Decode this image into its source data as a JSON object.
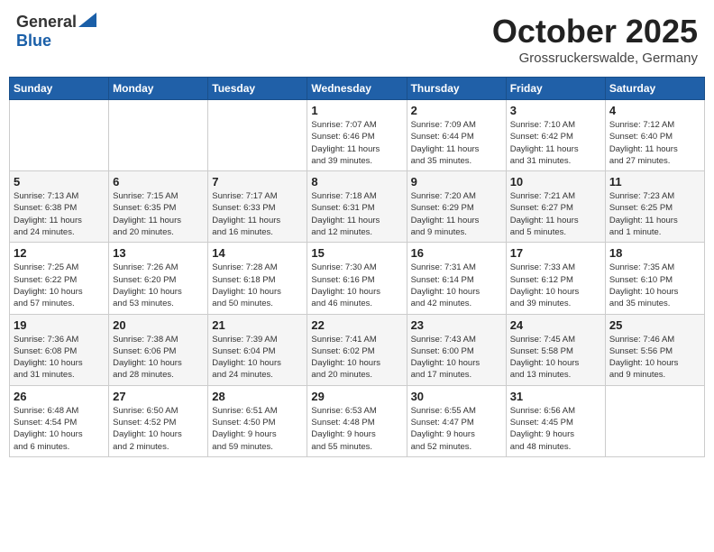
{
  "header": {
    "logo_general": "General",
    "logo_blue": "Blue",
    "month": "October 2025",
    "location": "Grossruckerswalde, Germany"
  },
  "days_of_week": [
    "Sunday",
    "Monday",
    "Tuesday",
    "Wednesday",
    "Thursday",
    "Friday",
    "Saturday"
  ],
  "weeks": [
    [
      {
        "day": "",
        "info": ""
      },
      {
        "day": "",
        "info": ""
      },
      {
        "day": "",
        "info": ""
      },
      {
        "day": "1",
        "info": "Sunrise: 7:07 AM\nSunset: 6:46 PM\nDaylight: 11 hours\nand 39 minutes."
      },
      {
        "day": "2",
        "info": "Sunrise: 7:09 AM\nSunset: 6:44 PM\nDaylight: 11 hours\nand 35 minutes."
      },
      {
        "day": "3",
        "info": "Sunrise: 7:10 AM\nSunset: 6:42 PM\nDaylight: 11 hours\nand 31 minutes."
      },
      {
        "day": "4",
        "info": "Sunrise: 7:12 AM\nSunset: 6:40 PM\nDaylight: 11 hours\nand 27 minutes."
      }
    ],
    [
      {
        "day": "5",
        "info": "Sunrise: 7:13 AM\nSunset: 6:38 PM\nDaylight: 11 hours\nand 24 minutes."
      },
      {
        "day": "6",
        "info": "Sunrise: 7:15 AM\nSunset: 6:35 PM\nDaylight: 11 hours\nand 20 minutes."
      },
      {
        "day": "7",
        "info": "Sunrise: 7:17 AM\nSunset: 6:33 PM\nDaylight: 11 hours\nand 16 minutes."
      },
      {
        "day": "8",
        "info": "Sunrise: 7:18 AM\nSunset: 6:31 PM\nDaylight: 11 hours\nand 12 minutes."
      },
      {
        "day": "9",
        "info": "Sunrise: 7:20 AM\nSunset: 6:29 PM\nDaylight: 11 hours\nand 9 minutes."
      },
      {
        "day": "10",
        "info": "Sunrise: 7:21 AM\nSunset: 6:27 PM\nDaylight: 11 hours\nand 5 minutes."
      },
      {
        "day": "11",
        "info": "Sunrise: 7:23 AM\nSunset: 6:25 PM\nDaylight: 11 hours\nand 1 minute."
      }
    ],
    [
      {
        "day": "12",
        "info": "Sunrise: 7:25 AM\nSunset: 6:22 PM\nDaylight: 10 hours\nand 57 minutes."
      },
      {
        "day": "13",
        "info": "Sunrise: 7:26 AM\nSunset: 6:20 PM\nDaylight: 10 hours\nand 53 minutes."
      },
      {
        "day": "14",
        "info": "Sunrise: 7:28 AM\nSunset: 6:18 PM\nDaylight: 10 hours\nand 50 minutes."
      },
      {
        "day": "15",
        "info": "Sunrise: 7:30 AM\nSunset: 6:16 PM\nDaylight: 10 hours\nand 46 minutes."
      },
      {
        "day": "16",
        "info": "Sunrise: 7:31 AM\nSunset: 6:14 PM\nDaylight: 10 hours\nand 42 minutes."
      },
      {
        "day": "17",
        "info": "Sunrise: 7:33 AM\nSunset: 6:12 PM\nDaylight: 10 hours\nand 39 minutes."
      },
      {
        "day": "18",
        "info": "Sunrise: 7:35 AM\nSunset: 6:10 PM\nDaylight: 10 hours\nand 35 minutes."
      }
    ],
    [
      {
        "day": "19",
        "info": "Sunrise: 7:36 AM\nSunset: 6:08 PM\nDaylight: 10 hours\nand 31 minutes."
      },
      {
        "day": "20",
        "info": "Sunrise: 7:38 AM\nSunset: 6:06 PM\nDaylight: 10 hours\nand 28 minutes."
      },
      {
        "day": "21",
        "info": "Sunrise: 7:39 AM\nSunset: 6:04 PM\nDaylight: 10 hours\nand 24 minutes."
      },
      {
        "day": "22",
        "info": "Sunrise: 7:41 AM\nSunset: 6:02 PM\nDaylight: 10 hours\nand 20 minutes."
      },
      {
        "day": "23",
        "info": "Sunrise: 7:43 AM\nSunset: 6:00 PM\nDaylight: 10 hours\nand 17 minutes."
      },
      {
        "day": "24",
        "info": "Sunrise: 7:45 AM\nSunset: 5:58 PM\nDaylight: 10 hours\nand 13 minutes."
      },
      {
        "day": "25",
        "info": "Sunrise: 7:46 AM\nSunset: 5:56 PM\nDaylight: 10 hours\nand 9 minutes."
      }
    ],
    [
      {
        "day": "26",
        "info": "Sunrise: 6:48 AM\nSunset: 4:54 PM\nDaylight: 10 hours\nand 6 minutes."
      },
      {
        "day": "27",
        "info": "Sunrise: 6:50 AM\nSunset: 4:52 PM\nDaylight: 10 hours\nand 2 minutes."
      },
      {
        "day": "28",
        "info": "Sunrise: 6:51 AM\nSunset: 4:50 PM\nDaylight: 9 hours\nand 59 minutes."
      },
      {
        "day": "29",
        "info": "Sunrise: 6:53 AM\nSunset: 4:48 PM\nDaylight: 9 hours\nand 55 minutes."
      },
      {
        "day": "30",
        "info": "Sunrise: 6:55 AM\nSunset: 4:47 PM\nDaylight: 9 hours\nand 52 minutes."
      },
      {
        "day": "31",
        "info": "Sunrise: 6:56 AM\nSunset: 4:45 PM\nDaylight: 9 hours\nand 48 minutes."
      },
      {
        "day": "",
        "info": ""
      }
    ]
  ]
}
